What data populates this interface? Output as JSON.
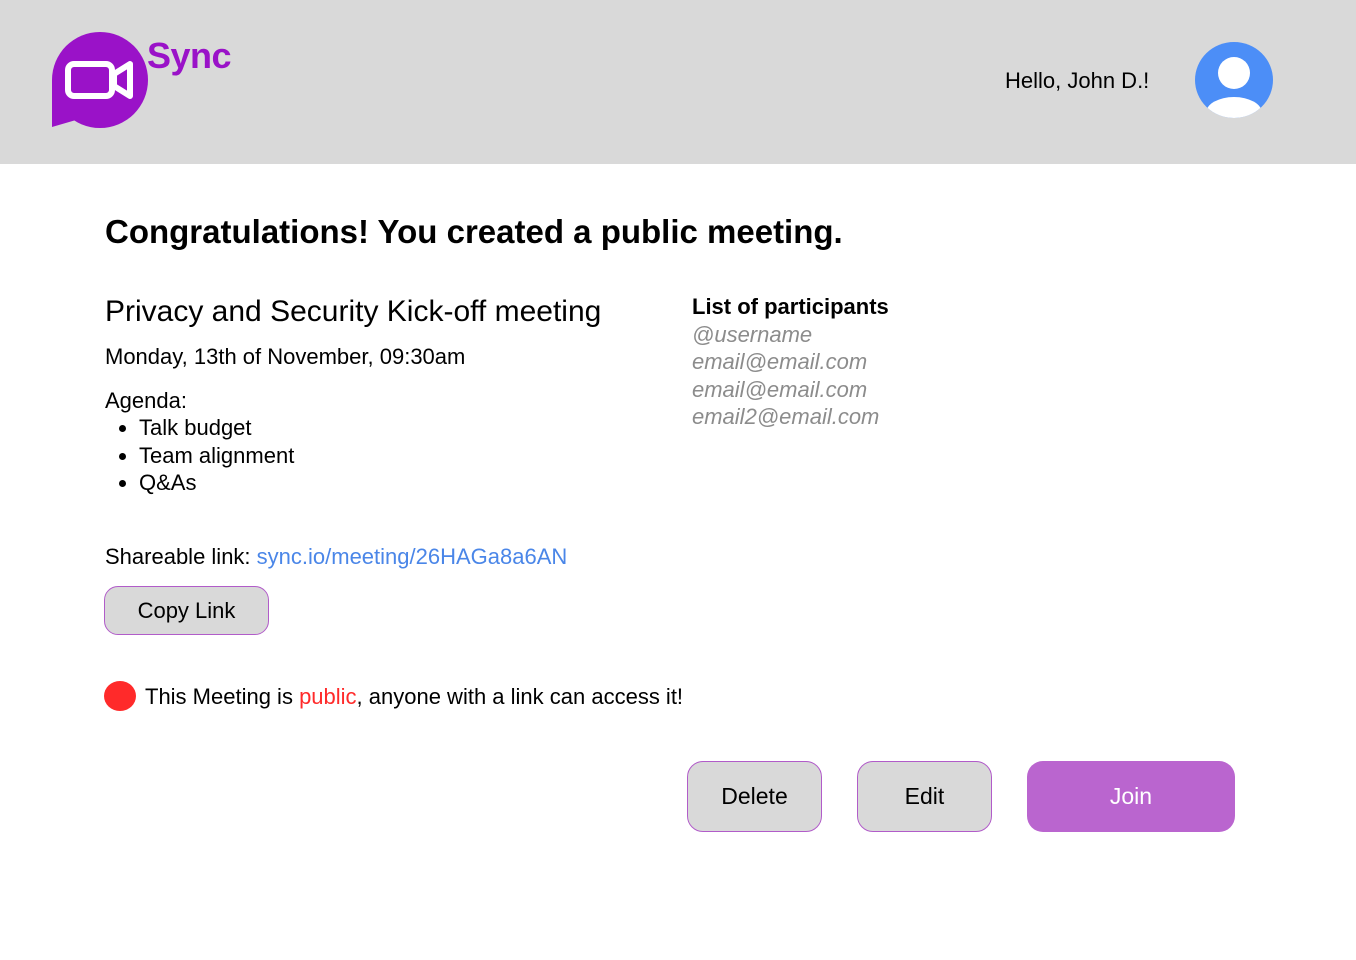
{
  "header": {
    "brand": "Sync",
    "greeting": "Hello, John D.!",
    "colors": {
      "brand": "#9a12c8",
      "avatar": "#4c8ef7",
      "header_bg": "#d9d9d9"
    }
  },
  "main": {
    "title": "Congratulations! You created a public meeting.",
    "meeting": {
      "title": "Privacy and Security Kick-off meeting",
      "date": "Monday, 13th of November, 09:30am",
      "agenda_label": "Agenda:",
      "agenda": [
        "Talk budget",
        "Team alignment",
        "Q&As"
      ]
    },
    "participants": {
      "title": "List of participants",
      "items": [
        "@username",
        "email@email.com",
        "email@email.com",
        "email2@email.com"
      ]
    },
    "share": {
      "label": "Shareable link: ",
      "link": "sync.io/meeting/26HAGa8a6AN",
      "copy_label": "Copy Link"
    },
    "notice": {
      "before": "This Meeting is ",
      "highlight": "public",
      "after": ", anyone with a link can access it!",
      "color": "#ff2a2a"
    },
    "actions": {
      "delete": "Delete",
      "edit": "Edit",
      "join": "Join"
    }
  }
}
